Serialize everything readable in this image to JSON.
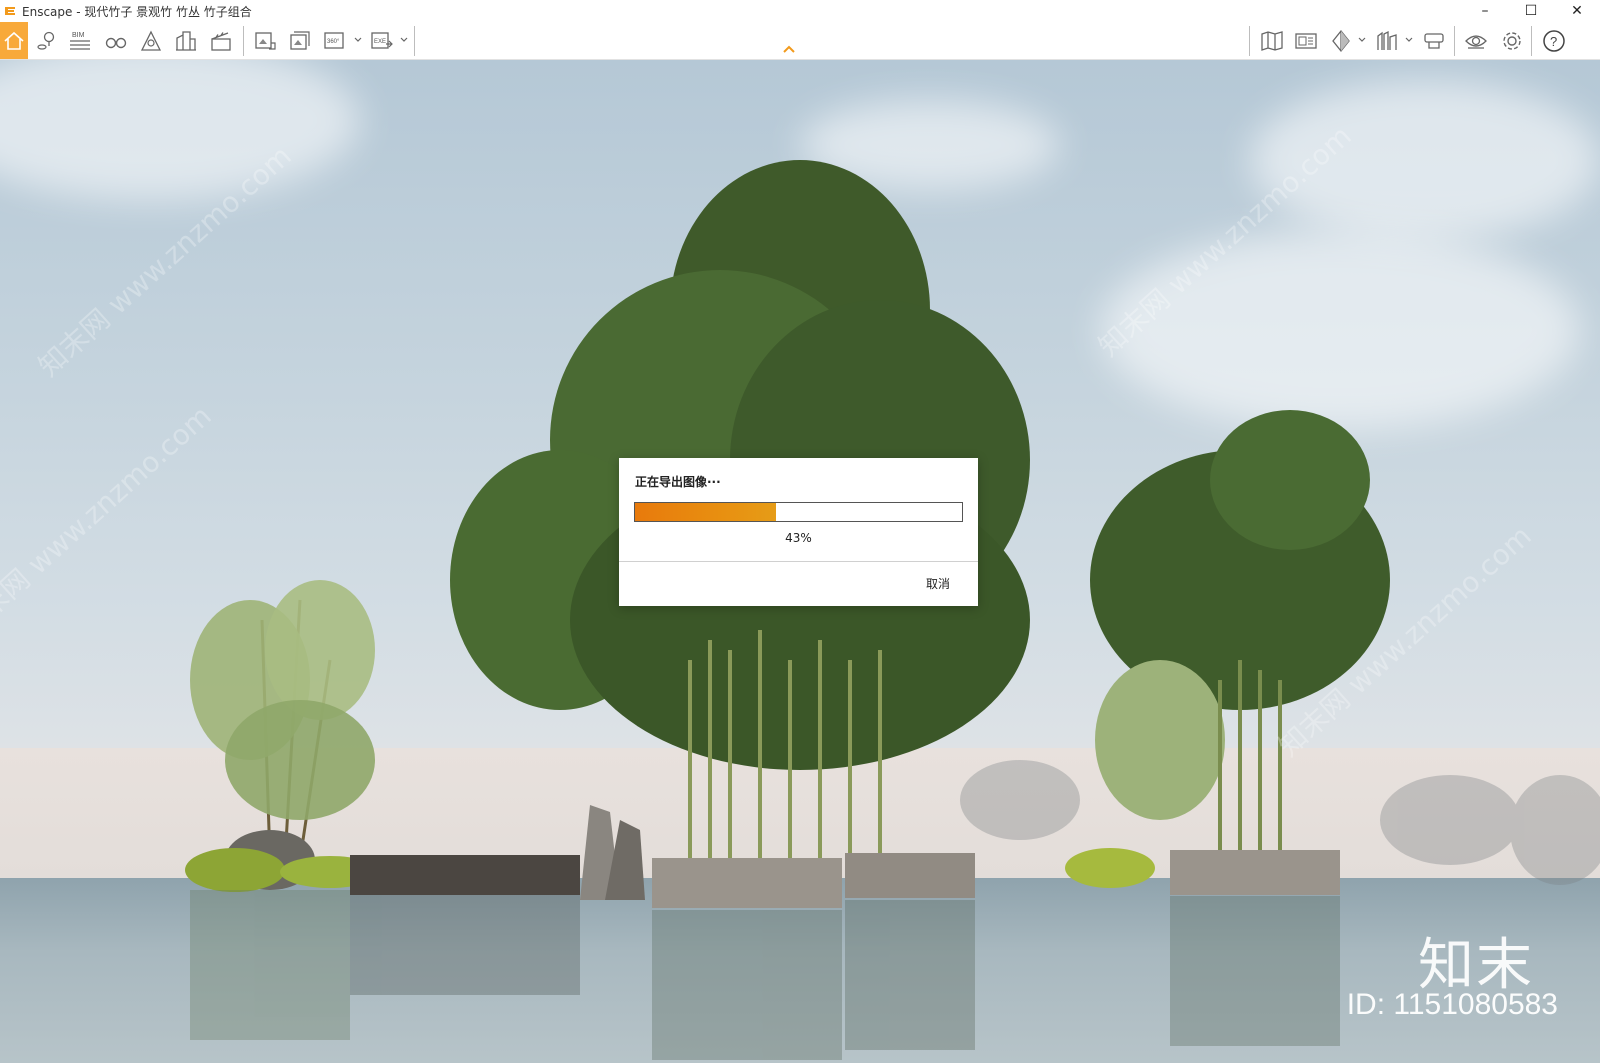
{
  "window": {
    "title": "Enscape - 现代竹子 景观竹 竹丛 竹子组合",
    "minimize": "–",
    "maximize": "☐",
    "close": "✕"
  },
  "toolbar": {
    "left_icons": [
      "home-icon",
      "map-pin-icon",
      "bim-icon",
      "binoculars-icon",
      "perspective-icon",
      "buildings-icon",
      "clapper-icon",
      "screenshot-icon",
      "batch-render-icon",
      "panorama-360-icon",
      "export-exe-icon"
    ],
    "right_icons": [
      "map-icon",
      "image-library-icon",
      "view-mode-icon",
      "asset-library-icon",
      "vr-headset-icon",
      "visual-settings-icon",
      "gear-icon",
      "help-icon"
    ],
    "bim_label": "BIM",
    "pano_label": "360°",
    "exe_label": "EXE",
    "help_label": "?",
    "accent_color": "#f8a93a"
  },
  "dialog": {
    "title": "正在导出图像···",
    "progress_percent": 43,
    "progress_text": "43%",
    "cancel_label": "取消",
    "progress_color": "#e87a0c"
  },
  "watermark": {
    "logo_text": "知末",
    "id_text": "ID: 1151080583",
    "diagonal_text": "知末网 www.znzmo.com"
  }
}
